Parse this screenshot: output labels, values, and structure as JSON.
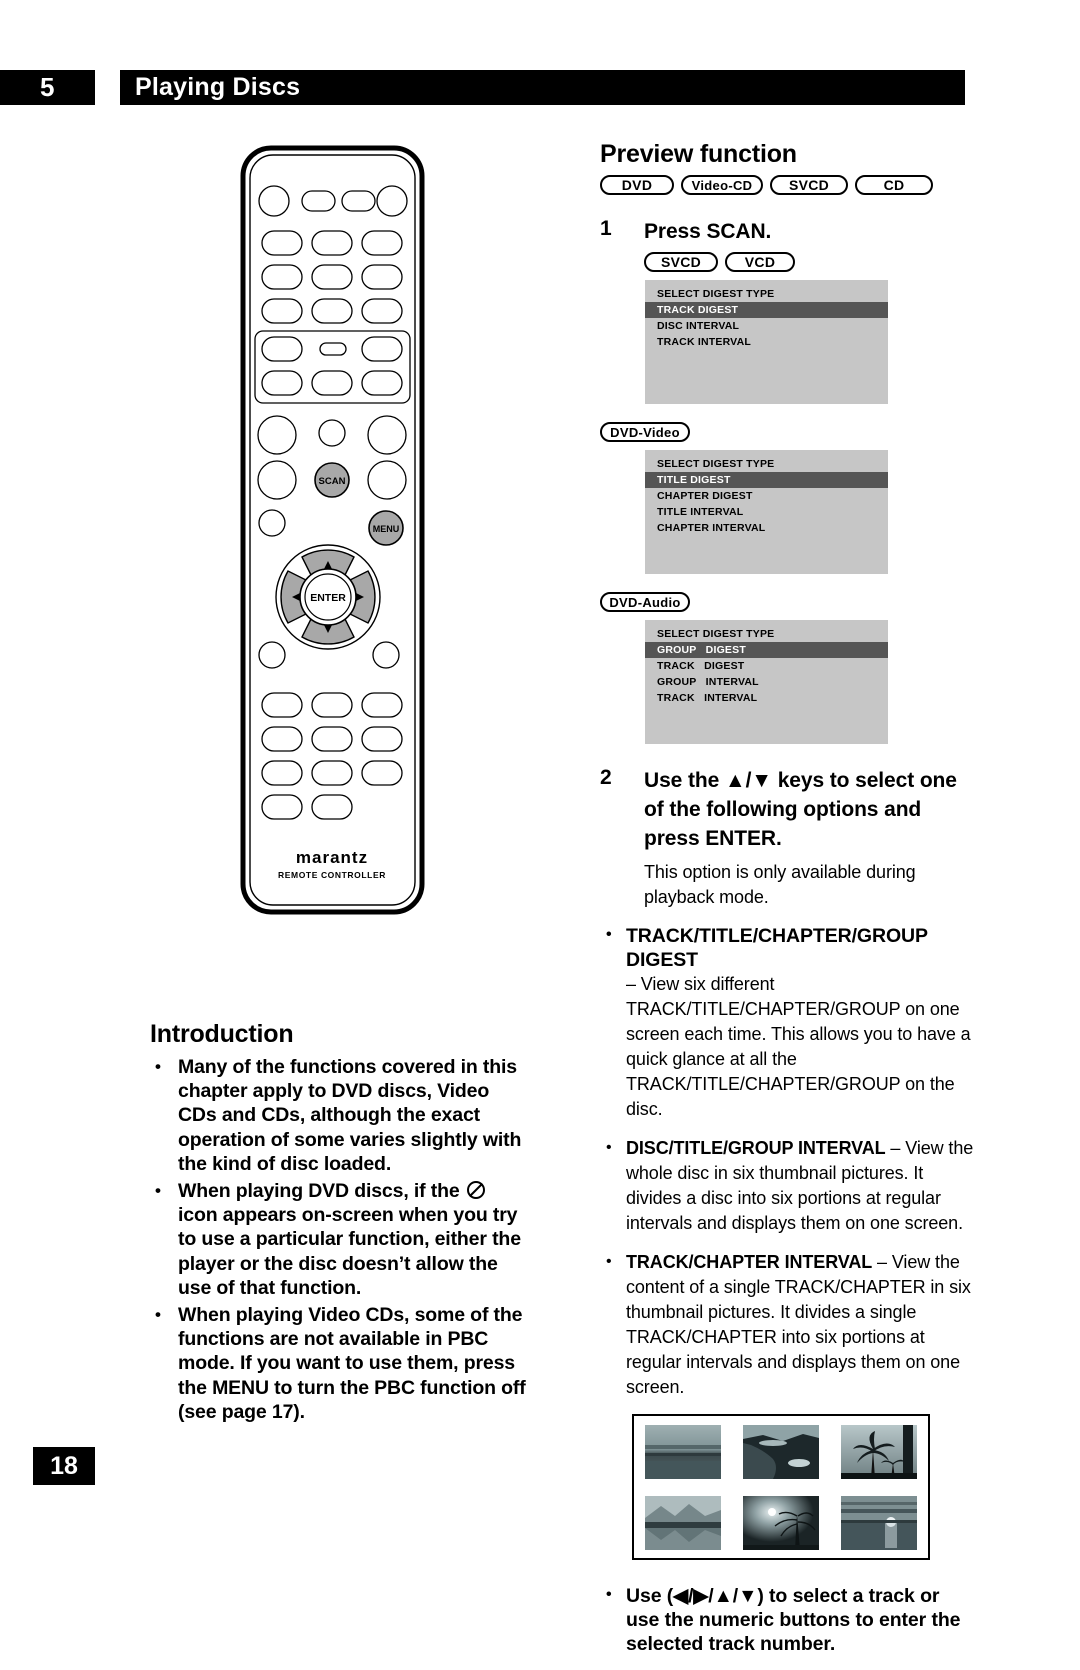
{
  "header": {
    "chapter_number": "5",
    "chapter_title": "Playing Discs"
  },
  "footer": {
    "page_number": "18"
  },
  "remote": {
    "brand": "marantz",
    "sublabel": "REMOTE CONTROLLER",
    "scan_button_label": "SCAN",
    "menu_button_label": "MENU",
    "enter_button_label": "ENTER"
  },
  "introduction": {
    "heading": "Introduction",
    "bullets": [
      "Many of the functions covered in this chapter apply to DVD discs, Video CDs and CDs, although the exact operation of some varies slightly with the kind of disc loaded.",
      "When playing DVD discs, if the ⊘ icon appears on-screen when you try to use a particular function, either the player or the disc doesn’t allow the use of that function.",
      "When playing Video CDs, some of the functions are not available in PBC mode. If you want to use them, press the MENU to turn the PBC function off (see page 17)."
    ],
    "bullet3_prefix": "When playing Video CDs, some of the functions are not available in PBC mode. If you want to use them, press the ",
    "bullet3_bold": "MENU",
    "bullet3_suffix": " to turn the PBC function off (see page 17)."
  },
  "preview": {
    "heading": "Preview function",
    "disc_pills": [
      "DVD",
      "Video-CD",
      "SVCD",
      "CD"
    ],
    "step1": {
      "number": "1",
      "text": "Press SCAN.",
      "pills": [
        "SVCD",
        "VCD"
      ]
    },
    "osd_svcd": {
      "rows": [
        {
          "label": "SELECT DIGEST TYPE",
          "selected": false
        },
        {
          "label": "TRACK DIGEST",
          "selected": true
        },
        {
          "label": "DISC INTERVAL",
          "selected": false
        },
        {
          "label": "TRACK INTERVAL",
          "selected": false
        }
      ]
    },
    "dvd_video_pill": "DVD-Video",
    "osd_dvd_video": {
      "rows": [
        {
          "label": "SELECT DIGEST TYPE",
          "selected": false
        },
        {
          "label": "TITLE DIGEST",
          "selected": true
        },
        {
          "label": "CHAPTER DIGEST",
          "selected": false
        },
        {
          "label": "TITLE INTERVAL",
          "selected": false
        },
        {
          "label": "CHAPTER INTERVAL",
          "selected": false
        }
      ]
    },
    "dvd_audio_pill": "DVD-Audio",
    "osd_dvd_audio": {
      "rows": [
        {
          "label": "SELECT DIGEST TYPE",
          "selected": false
        },
        {
          "label": "GROUP   DIGEST",
          "selected": true
        },
        {
          "label": "TRACK   DIGEST",
          "selected": false
        },
        {
          "label": "GROUP   INTERVAL",
          "selected": false
        },
        {
          "label": "TRACK   INTERVAL",
          "selected": false
        }
      ]
    },
    "step2": {
      "number": "2",
      "text": "Use the ▲/▼ keys to select one of the following options and press ENTER.",
      "subtext": "This option is only available during playback mode."
    },
    "options": [
      {
        "bold": "TRACK/TITLE/CHAPTER/GROUP DIGEST",
        "rest": "",
        "body": "– View six different TRACK/TITLE/CHAPTER/GROUP on one screen each time. This allows you to have a quick glance at all the TRACK/TITLE/CHAPTER/GROUP on the disc.",
        "style": "bold-heading"
      },
      {
        "bold": "DISC/TITLE/GROUP INTERVAL",
        "rest": " – View the whole disc in six thumbnail pictures. It divides a disc into six portions at regular intervals and displays them on one screen.",
        "body": "",
        "style": "inline"
      },
      {
        "bold": "TRACK/CHAPTER INTERVAL",
        "rest": " – View the content of a single TRACK/CHAPTER in six thumbnail pictures. It divides a single TRACK/CHAPTER into six portions at regular intervals and displays them on one screen.",
        "body": "",
        "style": "inline"
      }
    ],
    "final_bullet": "Use (◀/▶/▲/▼) to select a track or use the numeric buttons to enter the selected track number."
  },
  "colors": {
    "header_bar": "#000000",
    "osd_background": "#c6c6c6",
    "osd_selected": "#555555",
    "remote_button_highlight": "#a8a8a8"
  }
}
